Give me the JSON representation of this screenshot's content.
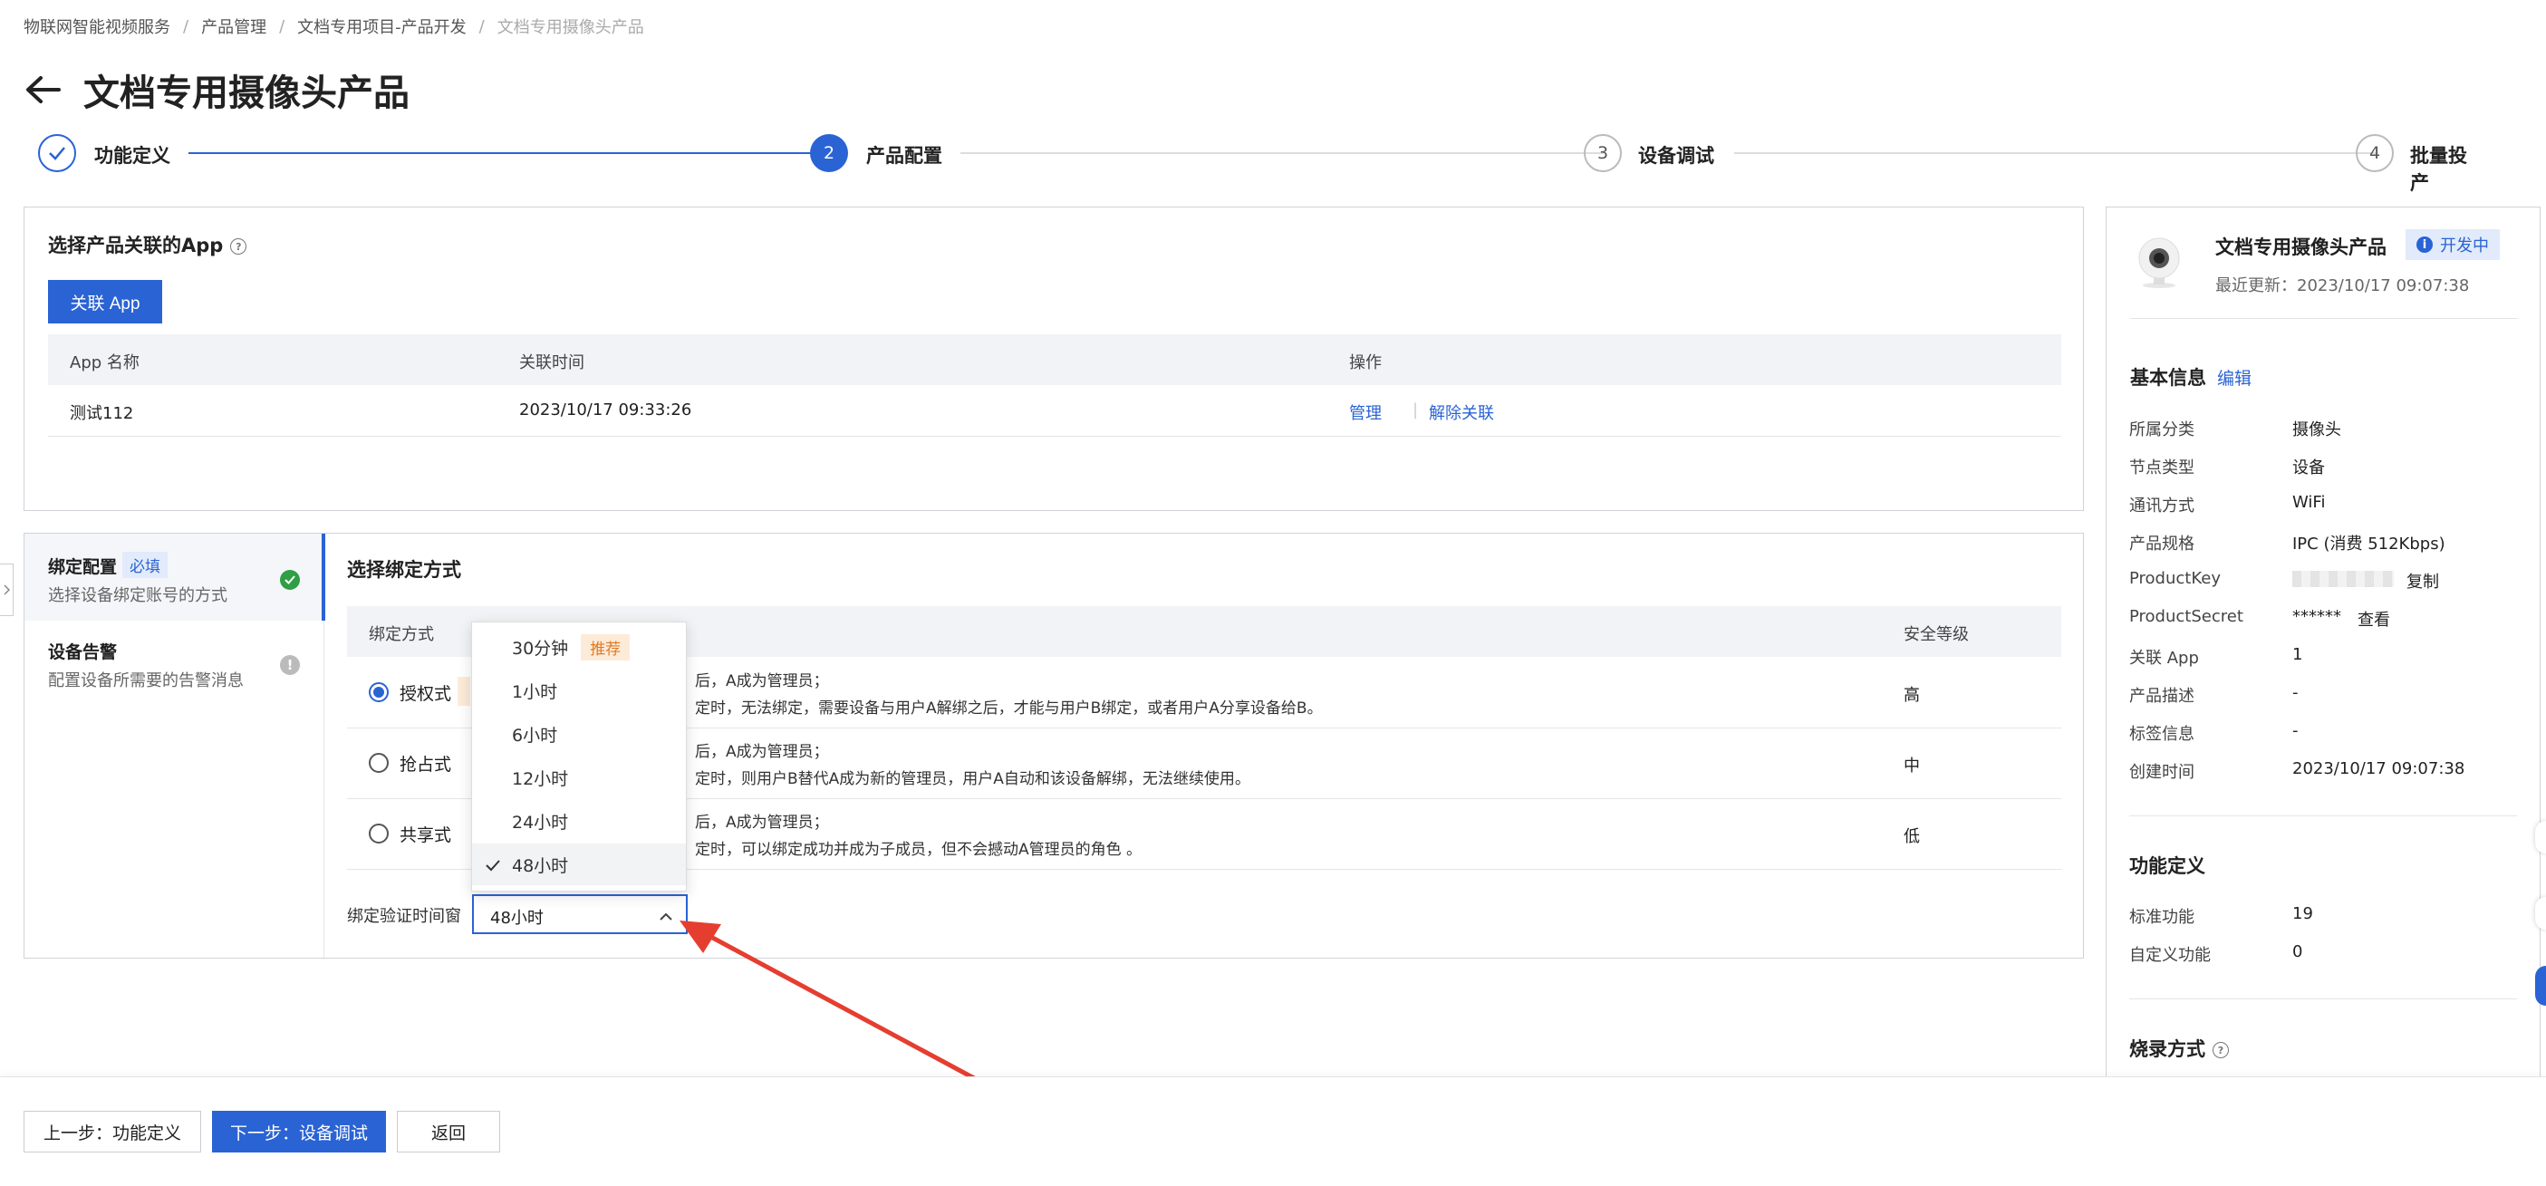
{
  "breadcrumb": [
    "物联网智能视频服务",
    "产品管理",
    "文档专用项目-产品开发",
    "文档专用摄像头产品"
  ],
  "page_title": "文档专用摄像头产品",
  "steps": [
    {
      "num": "1",
      "label": "功能定义",
      "state": "done"
    },
    {
      "num": "2",
      "label": "产品配置",
      "state": "active"
    },
    {
      "num": "3",
      "label": "设备调试",
      "state": "todo"
    },
    {
      "num": "4",
      "label": "批量投产",
      "state": "todo"
    }
  ],
  "app_section": {
    "title": "选择产品关联的App",
    "link_button": "关联 App",
    "columns": [
      "App 名称",
      "关联时间",
      "操作"
    ],
    "rows": [
      {
        "name": "测试112",
        "time": "2023/10/17 09:33:26",
        "manage": "管理",
        "unlink": "解除关联"
      }
    ]
  },
  "left_nav": [
    {
      "title": "绑定配置",
      "tag": "必填",
      "desc": "选择设备绑定账号的方式",
      "status": "done"
    },
    {
      "title": "设备告警",
      "desc": "配置设备所需要的告警消息",
      "status": "info"
    }
  ],
  "bind_section": {
    "title": "选择绑定方式",
    "col_mode": "绑定方式",
    "col_level": "安全等级",
    "rows": [
      {
        "mode": "授权式",
        "selected": true,
        "line1": "后，A成为管理员；",
        "line2": "定时，无法绑定，需要设备与用户A解绑之后，才能与用户B绑定，或者用户A分享设备给B。",
        "level": "高"
      },
      {
        "mode": "抢占式",
        "selected": false,
        "line1": "后，A成为管理员；",
        "line2": "定时，则用户B替代A成为新的管理员，用户A自动和该设备解绑，无法继续使用。",
        "level": "中"
      },
      {
        "mode": "共享式",
        "selected": false,
        "line1": "后，A成为管理员；",
        "line2": "定时，可以绑定成功并成为子成员，但不会撼动A管理员的角色 。",
        "level": "低"
      }
    ],
    "window_label": "绑定验证时间窗",
    "window_value": "48小时"
  },
  "dropdown": {
    "options": [
      {
        "label": "30分钟",
        "tag": "推荐"
      },
      {
        "label": "1小时"
      },
      {
        "label": "6小时"
      },
      {
        "label": "12小时"
      },
      {
        "label": "24小时"
      },
      {
        "label": "48小时",
        "selected": true
      }
    ]
  },
  "product_panel": {
    "name": "文档专用摄像头产品",
    "status": "开发中",
    "updated": "最近更新：2023/10/17 09:07:38",
    "basic_title": "基本信息",
    "edit": "编辑",
    "info": [
      {
        "k": "所属分类",
        "v": "摄像头"
      },
      {
        "k": "节点类型",
        "v": "设备"
      },
      {
        "k": "通讯方式",
        "v": "WiFi"
      },
      {
        "k": "产品规格",
        "v": "IPC (消费 512Kbps)"
      },
      {
        "k": "ProductKey",
        "v": "",
        "action": "复制"
      },
      {
        "k": "ProductSecret",
        "v": "******",
        "action": "查看"
      },
      {
        "k": "关联 App",
        "v": "1"
      },
      {
        "k": "产品描述",
        "v": "-"
      },
      {
        "k": "标签信息",
        "v": "-"
      },
      {
        "k": "创建时间",
        "v": "2023/10/17 09:07:38"
      }
    ],
    "func_title": "功能定义",
    "func": [
      {
        "k": "标准功能",
        "v": "19"
      },
      {
        "k": "自定义功能",
        "v": "0"
      }
    ],
    "burn_title": "烧录方式"
  },
  "footer": {
    "prev": "上一步：功能定义",
    "next": "下一步：设备调试",
    "back": "返回"
  },
  "colors": {
    "primary": "#2a63d4",
    "success": "#2f9e44",
    "arrow": "#e53e30"
  }
}
